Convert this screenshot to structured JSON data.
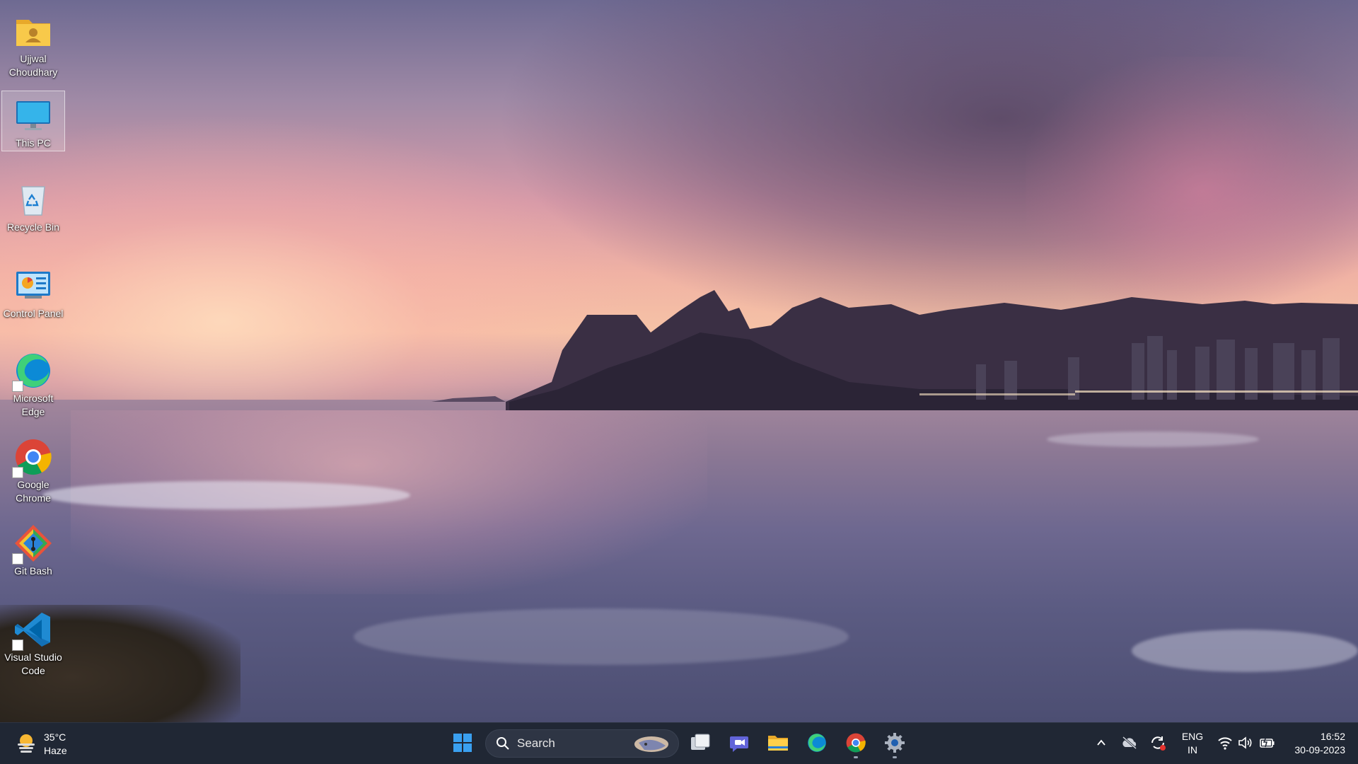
{
  "desktop": {
    "icons": [
      {
        "label": "Ujjwal Choudhary",
        "icon": "user-folder-icon"
      },
      {
        "label": "This PC",
        "icon": "monitor-icon",
        "selected": true
      },
      {
        "label": "Recycle Bin",
        "icon": "recycle-bin-icon"
      },
      {
        "label": "Control Panel",
        "icon": "control-panel-icon"
      },
      {
        "label": "Microsoft Edge",
        "icon": "edge-icon",
        "shortcut": true
      },
      {
        "label": "Google Chrome",
        "icon": "chrome-icon",
        "shortcut": true
      },
      {
        "label": "Git Bash",
        "icon": "git-bash-icon",
        "shortcut": true
      },
      {
        "label": "Visual Studio Code",
        "icon": "vscode-icon",
        "shortcut": true
      }
    ]
  },
  "taskbar": {
    "weather": {
      "temperature": "35°C",
      "condition": "Haze",
      "icon": "sun-haze-icon"
    },
    "search": {
      "label": "Search"
    },
    "apps": [
      {
        "name": "start",
        "icon": "windows-start-icon"
      },
      {
        "name": "task-view",
        "icon": "task-view-icon"
      },
      {
        "name": "teams-chat",
        "icon": "teams-chat-icon"
      },
      {
        "name": "file-explorer",
        "icon": "folder-icon"
      },
      {
        "name": "edge",
        "icon": "edge-icon"
      },
      {
        "name": "chrome",
        "icon": "chrome-icon",
        "running": true
      },
      {
        "name": "settings",
        "icon": "gear-icon",
        "running": true
      }
    ],
    "tray": {
      "language_line1": "ENG",
      "language_line2": "IN",
      "time": "16:52",
      "date": "30-09-2023"
    }
  },
  "colors": {
    "taskbar_bg": "#202734",
    "accent_blue": "#1e90ff"
  }
}
